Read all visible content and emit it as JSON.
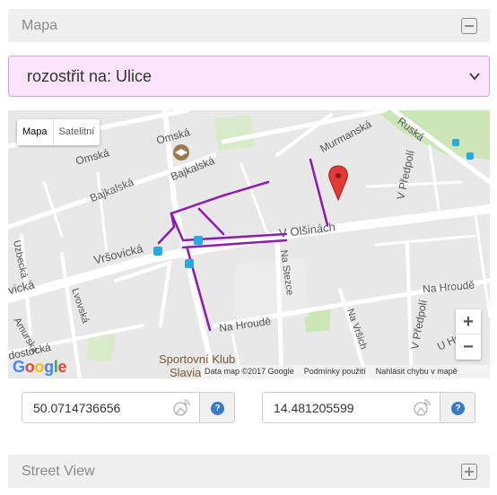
{
  "panels": {
    "map": {
      "title": "Mapa"
    },
    "street_view": {
      "title": "Street View"
    }
  },
  "select": {
    "value": "rozostřit na: Ulice"
  },
  "map": {
    "type_options": [
      "Mapa",
      "Satelitní"
    ],
    "active_type": "Mapa",
    "zoom_in": "+",
    "zoom_out": "−",
    "logo": "Google",
    "footer": [
      "Data map ©2017 Google",
      "Podmínky použití",
      "Nahlásit chybu v mapě"
    ],
    "labels": {
      "omska1": "Omská",
      "omska2": "Omská",
      "bajkalska1": "Bajkalská",
      "bajkalska2": "Bajkalská",
      "murmanska": "Murmanská",
      "ruska": "Ruská",
      "vpredpoli1": "V Předpolí",
      "vpredpoli2": "V Předpolí",
      "volsinach": "V Olšinách",
      "vrsovicka1": "Vršovická",
      "vrsovicka2": "vická",
      "uzbecka": "Uzbecká",
      "lvovska": "Lvovská",
      "amurska": "Amurská",
      "nastezce": "Na Stezce",
      "nahroude1": "Na Hroudě",
      "nahroude2": "Na Hroudě",
      "uhr": "U Hr",
      "navrsich": "Na Vršich",
      "dostocka": "dostocká",
      "sportovni": "Sportovní Klub",
      "slavia": "Slavia"
    },
    "route_color": "#8e1bb0"
  },
  "coords": {
    "lat": "50.0714736656",
    "lng": "14.481205599",
    "help": "?"
  }
}
